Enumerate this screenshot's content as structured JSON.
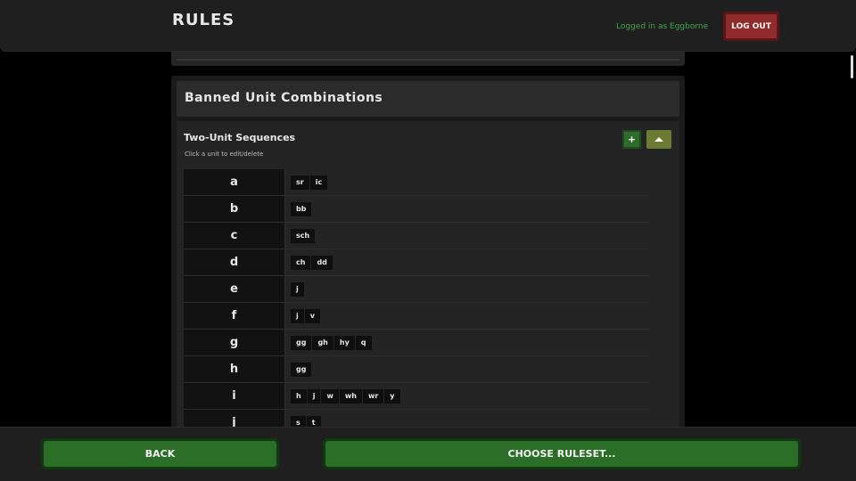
{
  "header": {
    "title": "RULES",
    "login_status": "Logged in as Eggborne",
    "logout_label": "LOG OUT"
  },
  "section": {
    "title": "Banned Unit Combinations"
  },
  "subsection": {
    "title": "Two-Unit Sequences",
    "hint": "Click a unit to edit/delete",
    "add_label": "+",
    "collapse_icon": "triangle-up-icon"
  },
  "rows": [
    {
      "key": "a",
      "values": [
        "sr",
        "ic"
      ]
    },
    {
      "key": "b",
      "values": [
        "bb"
      ]
    },
    {
      "key": "c",
      "values": [
        "sch"
      ]
    },
    {
      "key": "d",
      "values": [
        "ch",
        "dd"
      ]
    },
    {
      "key": "e",
      "values": [
        "j"
      ]
    },
    {
      "key": "f",
      "values": [
        "j",
        "v"
      ]
    },
    {
      "key": "g",
      "values": [
        "gg",
        "gh",
        "hy",
        "q"
      ]
    },
    {
      "key": "h",
      "values": [
        "gg"
      ]
    },
    {
      "key": "i",
      "values": [
        "h",
        "j",
        "w",
        "wh",
        "wr",
        "y"
      ]
    },
    {
      "key": "j",
      "values": [
        "s",
        "t"
      ]
    }
  ],
  "footer": {
    "back_label": "BACK",
    "choose_label": "CHOOSE RULESET..."
  },
  "colors": {
    "accent_green": "#2a6e28",
    "logout_red": "#8f2b2b",
    "status_green": "#3fa64a"
  }
}
